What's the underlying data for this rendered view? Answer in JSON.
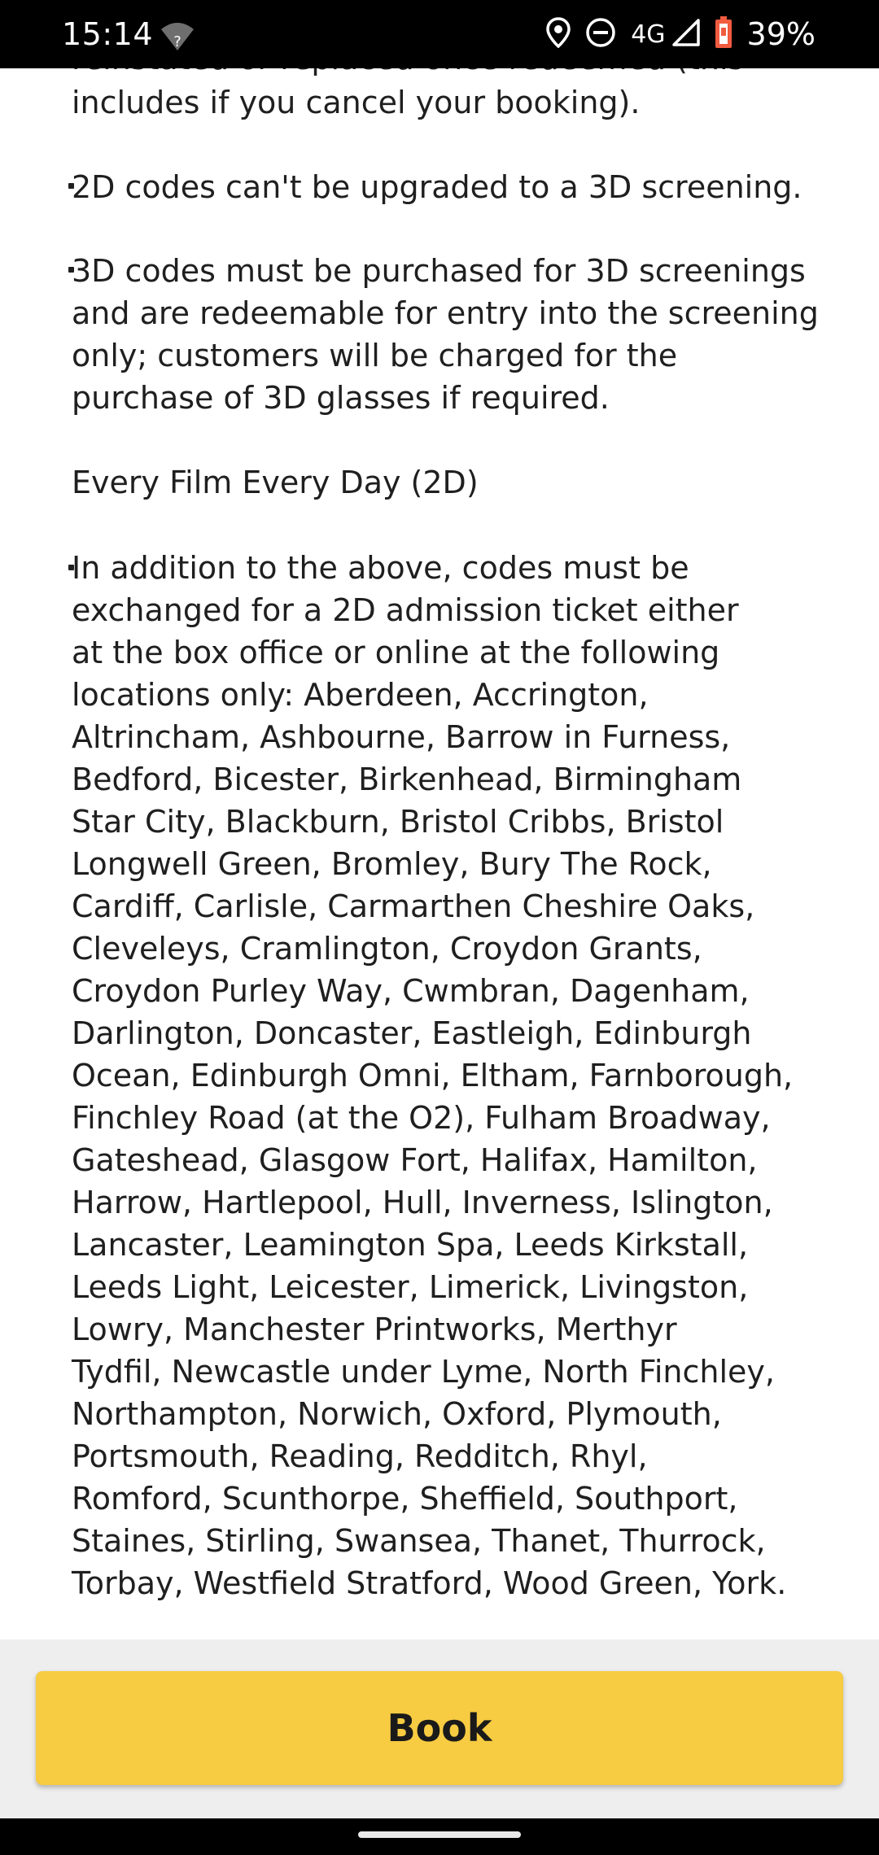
{
  "status_bar": {
    "time": "15:14",
    "network": "4G",
    "battery": "39%",
    "icons": [
      "wifi-unknown-icon",
      "location-icon",
      "do-not-disturb-icon",
      "signal-icon",
      "battery-low-icon"
    ]
  },
  "content": {
    "cut_line": "reinstated or replaced once redeemed (this",
    "p1": [
      "includes if you cancel your booking)."
    ],
    "p2": [
      "2D codes can't be upgraded to a 3D screening."
    ],
    "p3": [
      "3D codes must be purchased for 3D screenings",
      "and are redeemable for entry into the screening",
      "only; customers will be charged for the",
      "purchase of 3D glasses if required."
    ],
    "heading": "Every Film Every Day (2D)",
    "p4": [
      "In addition to the above, codes must be",
      "exchanged for a 2D admission ticket either",
      "at the box office or online at the following",
      "locations only: Aberdeen, Accrington,",
      "Altrincham, Ashbourne, Barrow in Furness,",
      "Bedford, Bicester, Birkenhead, Birmingham",
      "Star City, Blackburn, Bristol Cribbs, Bristol",
      "Longwell Green, Bromley, Bury The Rock,",
      "Cardiff, Carlisle, Carmarthen Cheshire Oaks,",
      "Cleveleys, Cramlington, Croydon Grants,",
      "Croydon Purley Way, Cwmbran, Dagenham,",
      "Darlington, Doncaster, Eastleigh, Edinburgh",
      "Ocean, Edinburgh Omni, Eltham, Farnborough,",
      "Finchley Road (at the O2), Fulham Broadway,",
      "Gateshead, Glasgow Fort, Halifax, Hamilton,",
      "Harrow, Hartlepool, Hull, Inverness, Islington,",
      "Lancaster, Leamington Spa, Leeds Kirkstall,",
      "Leeds Light, Leicester, Limerick, Livingston,",
      "Lowry, Manchester Printworks, Merthyr",
      "Tydfil, Newcastle under Lyme, North Finchley,",
      "Northampton, Norwich, Oxford, Plymouth,",
      "Portsmouth, Reading, Redditch, Rhyl,",
      "Romford, Scunthorpe, Sheffield, Southport,",
      "Staines, Stirling, Swansea, Thanet, Thurrock,",
      "Torbay, Westfield Stratford, Wood Green, York."
    ]
  },
  "footer": {
    "book_label": "Book"
  },
  "colors": {
    "accent": "#f7cb42",
    "footer_bg": "#eeeeee",
    "text": "#1f1f1f"
  }
}
